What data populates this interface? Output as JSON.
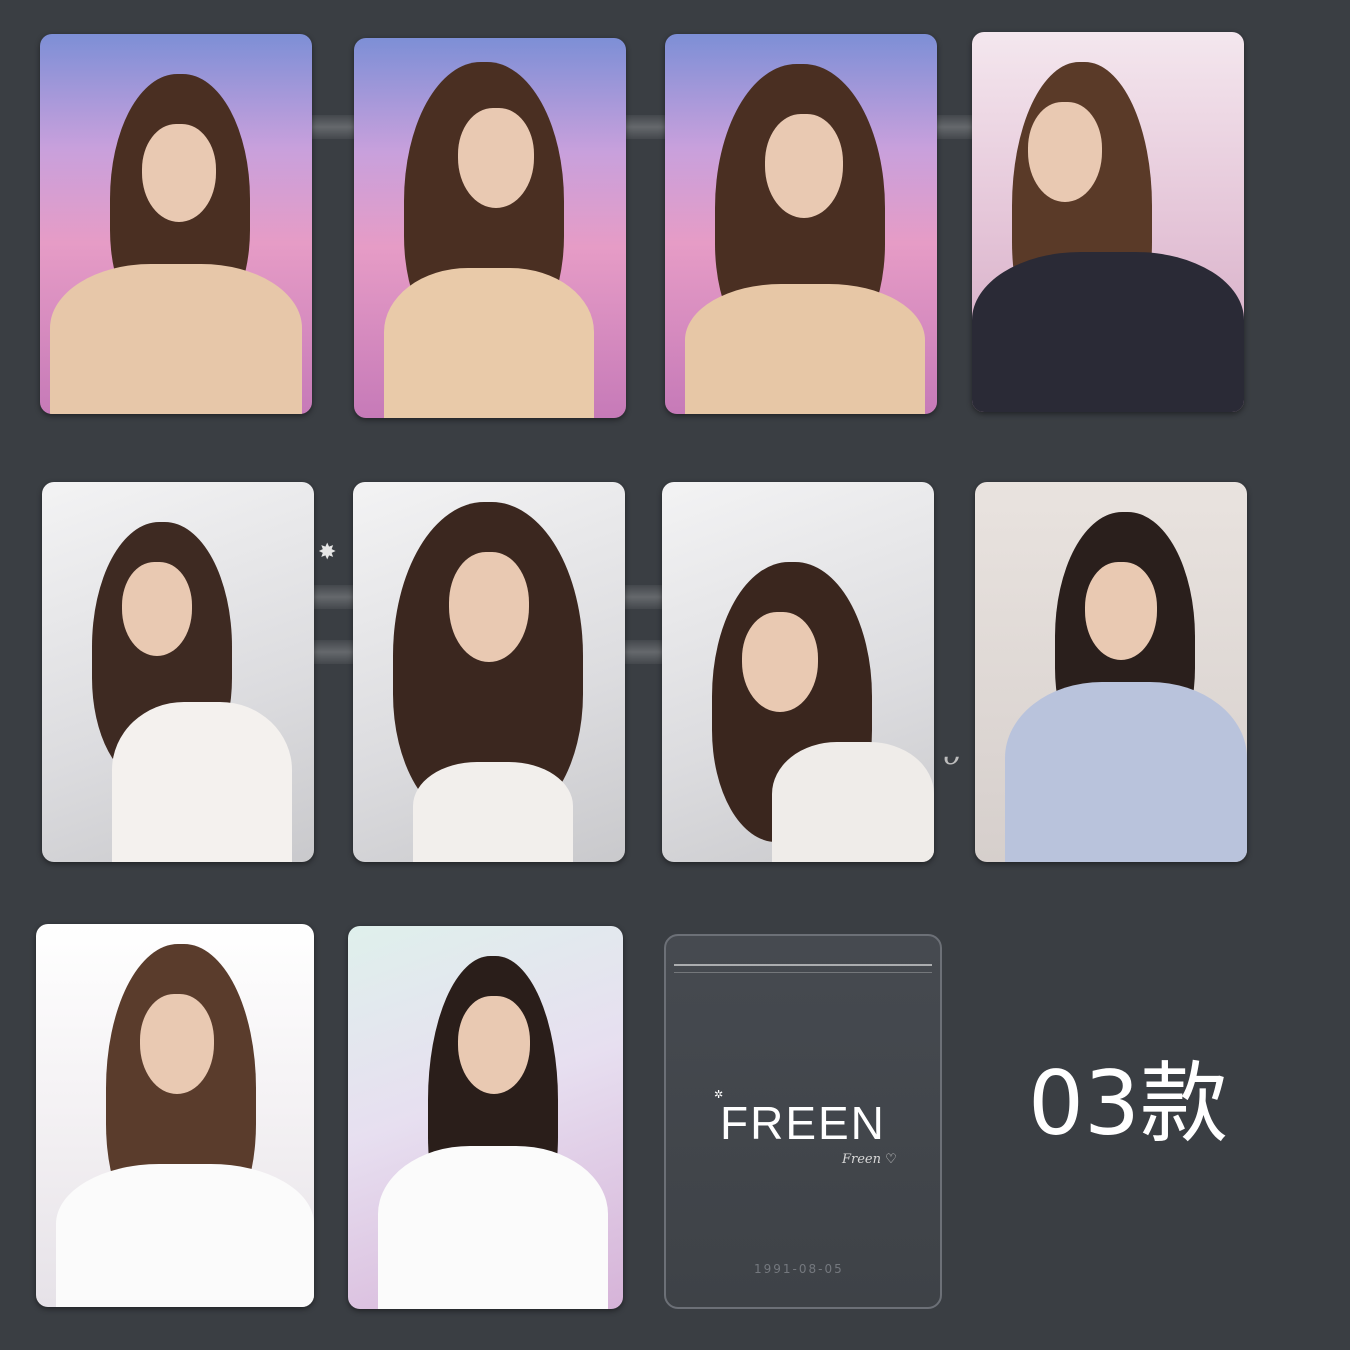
{
  "gallery": {
    "cards": [
      {
        "id": "card-1",
        "scene": "sunset"
      },
      {
        "id": "card-2",
        "scene": "sunset"
      },
      {
        "id": "card-3",
        "scene": "sunset"
      },
      {
        "id": "card-4",
        "scene": "office"
      },
      {
        "id": "card-5",
        "scene": "studio"
      },
      {
        "id": "card-6",
        "scene": "studio"
      },
      {
        "id": "card-7",
        "scene": "studio"
      },
      {
        "id": "card-8",
        "scene": "desk"
      },
      {
        "id": "card-9",
        "scene": "bright"
      },
      {
        "id": "card-10",
        "scene": "party"
      }
    ]
  },
  "sleeve": {
    "title": "FREEN",
    "mark": "✲",
    "signature": "Freen ♡",
    "date": "1991-08-05"
  },
  "variant_label": "03款",
  "colors": {
    "background": "#3a3e43",
    "text": "#ffffff"
  }
}
